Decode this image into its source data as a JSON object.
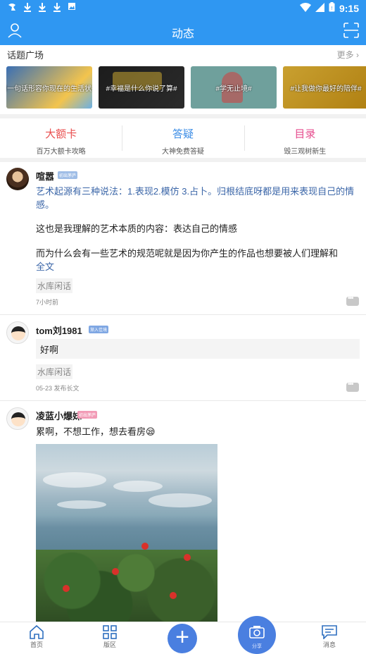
{
  "status_bar": {
    "time": "9:15",
    "left_icons": [
      "notification-icon",
      "download-icon",
      "download-icon",
      "download-icon",
      "image-icon"
    ],
    "right_icons": [
      "wifi-icon",
      "signal-icon",
      "battery-icon"
    ]
  },
  "app_bar": {
    "title": "动态",
    "left_icon": "user-icon",
    "right_icon": "scan-icon"
  },
  "topic_square": {
    "title": "话题广场",
    "more": "更多",
    "cards": [
      {
        "label": "#用一句话形容你现在的生活状态#"
      },
      {
        "label": "#幸福是什么你说了算#"
      },
      {
        "label": "#学无止境#"
      },
      {
        "label": "#让我做你最好的陪伴#"
      }
    ]
  },
  "entries": [
    {
      "main": "大额卡",
      "sub": "百万大额卡攻略",
      "color": "#e94e4e"
    },
    {
      "main": "答疑",
      "sub": "大神免费答疑",
      "color": "#3c8de6"
    },
    {
      "main": "目录",
      "sub": "毁三观树新生",
      "color": "#e64b8d"
    }
  ],
  "posts": [
    {
      "user": "喧嚣",
      "badge": "初出茅庐",
      "highlight": "艺术起源有三种说法：1.表现2.模仿 3.占卜。归根结底呀都是用来表现自己的情感。",
      "para2": "这也是我理解的艺术本质的内容：表达自己的情感",
      "para3": "而为什么会有一些艺术的规范呢就是因为你产生的作品也想要被人们理解和",
      "full_text": "全文",
      "tag": "水库闲话",
      "time": "7小时前"
    },
    {
      "user": "tom刘1981",
      "badge": "渐入佳境",
      "quote": "好啊",
      "tag": "水库闲话",
      "time": "05-23",
      "extra": "发布长文"
    },
    {
      "user": "凌蓝小爆妹",
      "badge": "初出茅庐",
      "text": "累啊，不想工作，想去看房😪"
    }
  ],
  "bottom_nav": {
    "home": "首页",
    "sections": "版区",
    "share": "分享",
    "messages": "消息"
  }
}
